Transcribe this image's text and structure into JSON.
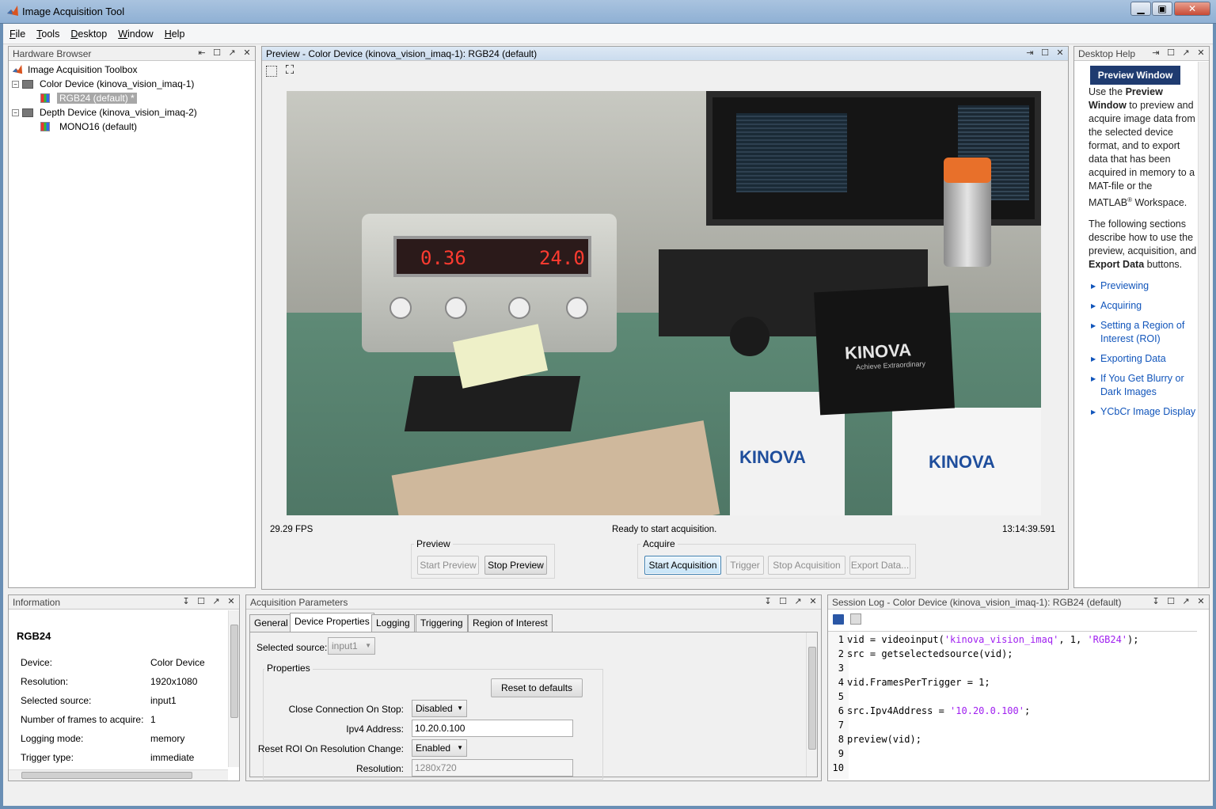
{
  "window": {
    "title": "Image Acquisition Tool"
  },
  "menu": [
    "File",
    "Tools",
    "Desktop",
    "Window",
    "Help"
  ],
  "hardware_browser": {
    "title": "Hardware Browser",
    "root": "Image Acquisition Toolbox",
    "devices": [
      {
        "label": "Color Device (kinova_vision_imaq-1)",
        "formats": [
          "RGB24 (default) *"
        ]
      },
      {
        "label": "Depth Device (kinova_vision_imaq-2)",
        "formats": [
          "MONO16 (default)"
        ]
      }
    ]
  },
  "preview": {
    "title": "Preview - Color Device (kinova_vision_imaq-1): RGB24 (default)",
    "fps": "29.29 FPS",
    "status": "Ready to start acquisition.",
    "timestamp": "13:14:39.591",
    "display": {
      "left_value": "0.36",
      "right_value": "24.0"
    },
    "brand_text": "KINOVA",
    "tagline": "Achieve Extraordinary",
    "preview_group": "Preview",
    "acquire_group": "Acquire",
    "buttons": {
      "start_preview": "Start Preview",
      "stop_preview": "Stop Preview",
      "start_acquisition": "Start Acquisition",
      "trigger": "Trigger",
      "stop_acquisition": "Stop Acquisition",
      "export_data": "Export Data..."
    }
  },
  "help": {
    "title": "Desktop Help",
    "heading": "Preview Window",
    "para1_a": "Use the",
    "para1_b": "Preview Window",
    "para1_c": "to preview and acquire image data from the selected device format, and to export data that has been acquired in memory to a MAT-file or the MATLAB",
    "reg": "®",
    "para1_d": "Workspace.",
    "para2_a": "The following sections describe how to use the preview, acquisition, and",
    "para2_b": "Export Data",
    "para2_c": "buttons.",
    "links": [
      "Previewing",
      "Acquiring",
      "Setting a Region of Interest (ROI)",
      "Exporting Data",
      "If You Get Blurry or Dark Images",
      "YCbCr Image Display"
    ]
  },
  "information": {
    "title": "Information",
    "heading": "RGB24",
    "rows": [
      {
        "label": "Device:",
        "value": "Color Device"
      },
      {
        "label": "Resolution:",
        "value": "1920x1080"
      },
      {
        "label": "Selected source:",
        "value": "input1"
      },
      {
        "label": "Number of frames to acquire:",
        "value": "1"
      },
      {
        "label": "Logging mode:",
        "value": "memory"
      },
      {
        "label": "Trigger type:",
        "value": "immediate"
      }
    ]
  },
  "acq_params": {
    "title": "Acquisition Parameters",
    "tabs": [
      "General",
      "Device Properties",
      "Logging",
      "Triggering",
      "Region of Interest"
    ],
    "active_tab": "Device Properties",
    "selected_source_label": "Selected source:",
    "selected_source_value": "input1",
    "properties_group": "Properties",
    "reset_button": "Reset to defaults",
    "props": [
      {
        "label": "Close Connection On Stop:",
        "value": "Disabled"
      },
      {
        "label": "Ipv4 Address:",
        "value": "10.20.0.100"
      },
      {
        "label": "Reset ROI On Resolution Change:",
        "value": "Enabled"
      },
      {
        "label": "Resolution:",
        "value": "1280x720"
      }
    ]
  },
  "session_log": {
    "title": "Session Log - Color Device (kinova_vision_imaq-1): RGB24 (default)",
    "lines": [
      {
        "n": "1",
        "pre": "vid = videoinput(",
        "s1": "'kinova_vision_imaq'",
        "mid": ", 1, ",
        "s2": "'RGB24'",
        "post": ");"
      },
      {
        "n": "2",
        "pre": "src = getselectedsource(vid);"
      },
      {
        "n": "3",
        "pre": ""
      },
      {
        "n": "4",
        "pre": "vid.FramesPerTrigger = 1;"
      },
      {
        "n": "5",
        "pre": ""
      },
      {
        "n": "6",
        "pre": "src.Ipv4Address = ",
        "s1": "'10.20.0.100'",
        "post": ";"
      },
      {
        "n": "7",
        "pre": ""
      },
      {
        "n": "8",
        "pre": "preview(vid);"
      },
      {
        "n": "9",
        "pre": ""
      },
      {
        "n": "10",
        "pre": ""
      }
    ]
  },
  "colors": {
    "accent": "#1f4e9c",
    "link": "#1155bb",
    "string": "#a020f0"
  }
}
